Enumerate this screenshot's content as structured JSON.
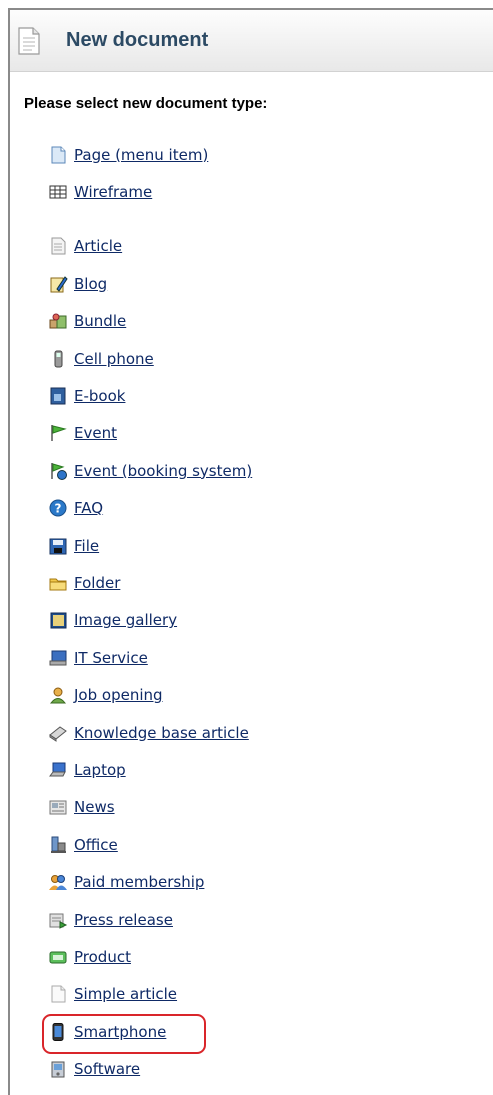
{
  "header": {
    "title": "New document",
    "icon": "document-icon"
  },
  "prompt": "Please select new document type:",
  "group1": [
    {
      "label": "Page (menu item)",
      "icon": "page-icon"
    },
    {
      "label": "Wireframe",
      "icon": "wireframe-icon"
    }
  ],
  "group2": [
    {
      "label": "Article",
      "icon": "article-icon"
    },
    {
      "label": "Blog",
      "icon": "blog-icon"
    },
    {
      "label": "Bundle",
      "icon": "bundle-icon"
    },
    {
      "label": "Cell phone",
      "icon": "cell-phone-icon"
    },
    {
      "label": "E-book",
      "icon": "ebook-icon"
    },
    {
      "label": "Event",
      "icon": "event-flag-icon"
    },
    {
      "label": "Event (booking system) ",
      "icon": "event-booking-icon"
    },
    {
      "label": "FAQ",
      "icon": "faq-icon"
    },
    {
      "label": "File",
      "icon": "file-icon"
    },
    {
      "label": "Folder",
      "icon": "folder-icon"
    },
    {
      "label": "Image gallery",
      "icon": "image-gallery-icon"
    },
    {
      "label": "IT Service",
      "icon": "it-service-icon"
    },
    {
      "label": "Job opening",
      "icon": "job-opening-icon"
    },
    {
      "label": "Knowledge base article",
      "icon": "knowledge-base-icon"
    },
    {
      "label": "Laptop",
      "icon": "laptop-icon"
    },
    {
      "label": "News",
      "icon": "news-icon"
    },
    {
      "label": "Office",
      "icon": "office-icon"
    },
    {
      "label": "Paid membership",
      "icon": "paid-membership-icon"
    },
    {
      "label": "Press release",
      "icon": "press-release-icon"
    },
    {
      "label": "Product",
      "icon": "product-icon"
    },
    {
      "label": "Simple article",
      "icon": "simple-article-icon"
    },
    {
      "label": "Smartphone",
      "icon": "smartphone-icon"
    },
    {
      "label": "Software",
      "icon": "software-icon"
    }
  ],
  "highlighted_item": "Smartphone",
  "colors": {
    "link": "#0f2a66",
    "header_title": "#2c4a64",
    "highlight": "#d9252a"
  }
}
